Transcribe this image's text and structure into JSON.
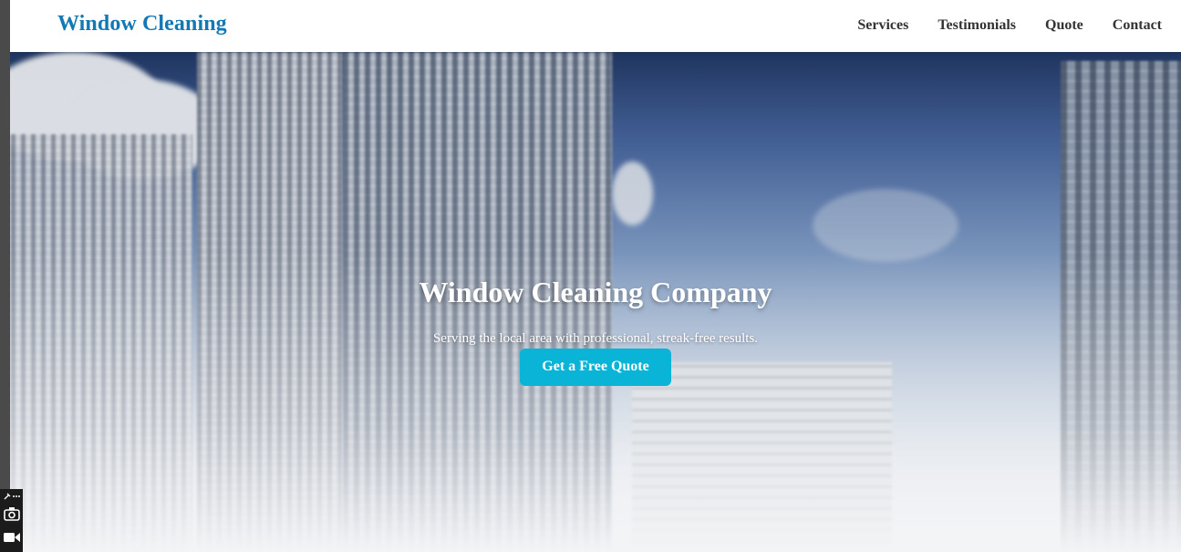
{
  "brand": {
    "name": "Window Cleaning",
    "color": "#1478b4"
  },
  "nav": {
    "items": [
      {
        "label": "Services"
      },
      {
        "label": "Testimonials"
      },
      {
        "label": "Quote"
      },
      {
        "label": "Contact"
      }
    ]
  },
  "hero": {
    "title": "Window Cleaning Company",
    "subtitle": "Serving the local area with professional, streak-free results.",
    "cta_label": "Get a Free Quote",
    "cta_color": "#0ab4d6",
    "background": "city-skyscrapers-photo"
  },
  "toolbar": {
    "items": [
      {
        "icon": "edit-more-icon",
        "glyph": "⚲ ⋯"
      },
      {
        "icon": "camera-icon"
      },
      {
        "icon": "video-camera-icon"
      }
    ]
  }
}
